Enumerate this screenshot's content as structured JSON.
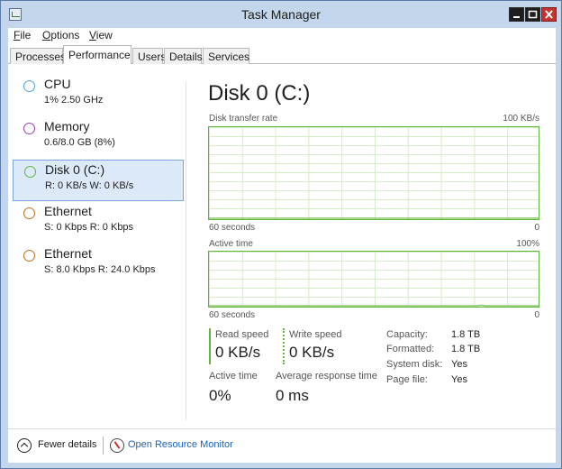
{
  "window": {
    "title": "Task Manager"
  },
  "menu": [
    {
      "label": "File",
      "accel": "F",
      "rest": "ile"
    },
    {
      "label": "Options",
      "accel": "O",
      "rest": "ptions"
    },
    {
      "label": "View",
      "accel": "V",
      "rest": "iew"
    }
  ],
  "tabs": [
    "Processes",
    "Performance",
    "Users",
    "Details",
    "Services"
  ],
  "active_tab": "Performance",
  "sidebar": [
    {
      "name": "CPU",
      "sub": "1% 2.50 GHz",
      "color": "#4aa3df",
      "selected": false
    },
    {
      "name": "Memory",
      "sub": "0.6/8.0 GB (8%)",
      "color": "#9b3fb5",
      "selected": false
    },
    {
      "name": "Disk 0 (C:)",
      "sub": "R: 0 KB/s W: 0 KB/s",
      "color": "#61b53a",
      "selected": true
    },
    {
      "name": "Ethernet",
      "sub": "S: 0 Kbps R: 0 Kbps",
      "color": "#c26e1c",
      "selected": false
    },
    {
      "name": "Ethernet",
      "sub": "S: 8.0 Kbps R: 24.0 Kbps",
      "color": "#c26e1c",
      "selected": false
    }
  ],
  "panel": {
    "title": "Disk 0 (C:)",
    "graph1": {
      "label": "Disk transfer rate",
      "max": "100 KB/s",
      "time": "60 seconds",
      "zero": "0"
    },
    "graph2": {
      "label": "Active time",
      "max": "100%",
      "time": "60 seconds",
      "zero": "0"
    },
    "stats": {
      "read_label": "Read speed",
      "read_value": "0 KB/s",
      "write_label": "Write speed",
      "write_value": "0 KB/s",
      "active_label": "Active time",
      "active_value": "0%",
      "resp_label": "Average response time",
      "resp_value": "0 ms"
    },
    "properties": [
      {
        "key": "Capacity:",
        "value": "1.8 TB"
      },
      {
        "key": "Formatted:",
        "value": "1.8 TB"
      },
      {
        "key": "System disk:",
        "value": "Yes"
      },
      {
        "key": "Page file:",
        "value": "Yes"
      }
    ]
  },
  "footer": {
    "fewer_details": "Fewer details",
    "fewer_accel": "d",
    "resource_monitor": "Open Resource Monitor"
  },
  "colors": {
    "accent_green": "#61b53a",
    "link": "#1f62b6",
    "selection": "#dce9f8"
  }
}
